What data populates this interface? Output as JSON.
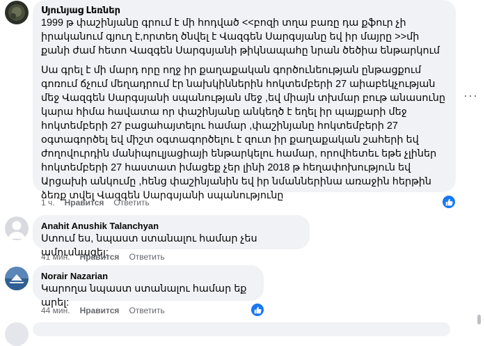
{
  "comments": [
    {
      "author": "Սյունյաց Լեռներ",
      "paragraphs": [
        "1999 թ փաշինյանը գրում է մի հոդված <<բոզի տղա բառը դա քֆուր չի իրականում գյուղ է,որտեղ ծնվել է Վազգեն Սարգսյանը եվ իր մայրը >>մի քանի ժամ հետո Վազգեն Սարգսյանի թիկնապահը նրան ծեծիա ենթարկում",
        "Սա գրել է մի մարդ որը ողջ իր քաղաքական գործունեության ընթացքում գոռում ճչում մեղադրում էր նախկիններին հոկտեմբերի 27 աիաբեկչության մեջ Վազգեն Սարգսյանի սպանության մեջ ,եվ միայն տխմար բութ անասունը կարա հիմա հավատա որ փաշինյանը անկեղծ է եղել իր պայքարի մեջ հոկտեմբերի 27 բացահայտելու համար ,փաշինյանը հոկտեմբերի 27 օգտագործել եվ միշտ օգտագործելու է զուտ իր քաղաքական շահերի եվ ժողովուրդին մանիպուլյացիայի ենթարկելու համար, որովհետեւ եթե չլիներ հոկտեմբերի 27 հաստատ իմացեք չեր լինի 2018 թ հեղափոխություն եվ Արցախի անկումը ,հենց փաշինյանին եվ իր նմաններինա առաջին հերթին ձեռք տվել Վազգեն Սարգսյանի սպանությունը"
      ],
      "time": "1 ч.",
      "like": "Нравится",
      "reply": "Ответить",
      "more": "···"
    },
    {
      "author": "Anahit Anushik Talanchyan",
      "text": "Ստում ես, նպաստ ստանալու համար չես ամուսնացել:",
      "time": "41 мин.",
      "like": "Нравится",
      "reply": "Ответить"
    },
    {
      "author": "Norair Nazarian",
      "text": "Կարողա նպաստ ստանալու համար եք արել:",
      "time": "44 мин.",
      "like": "Нравится",
      "reply": "Ответить"
    }
  ],
  "colors": {
    "bubble": "#f0f2f5",
    "like_blue": "#1877f2",
    "secondary_text": "#65676b"
  }
}
